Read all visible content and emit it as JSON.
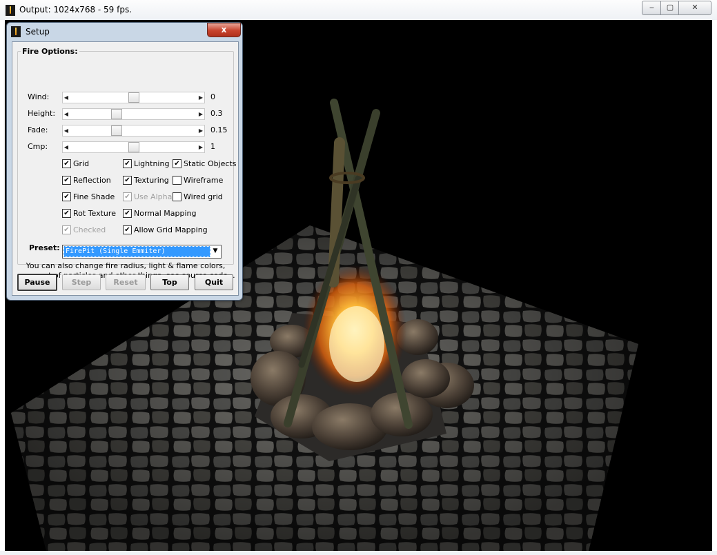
{
  "window": {
    "title": "Output: 1024x768 - 59 fps.",
    "controls": {
      "minimize": "▭",
      "maximize": "▣",
      "close": "✕"
    }
  },
  "setup": {
    "title": "Setup",
    "close": "x",
    "group_label": "Fire Options:",
    "sliders": [
      {
        "label": "Wind:",
        "value": "0",
        "position": 0.5
      },
      {
        "label": "Height:",
        "value": "0.3",
        "position": 0.35
      },
      {
        "label": "Fade:",
        "value": "0.15",
        "position": 0.35
      },
      {
        "label": "Cmp:",
        "value": "1",
        "position": 0.5
      }
    ],
    "checkboxes": {
      "grid": {
        "label": "Grid",
        "checked": true,
        "enabled": true
      },
      "lightning": {
        "label": "Lightning",
        "checked": true,
        "enabled": true
      },
      "static_objects": {
        "label": "Static Objects",
        "checked": true,
        "enabled": true
      },
      "reflection": {
        "label": "Reflection",
        "checked": true,
        "enabled": true
      },
      "texturing": {
        "label": "Texturing",
        "checked": true,
        "enabled": true
      },
      "wireframe": {
        "label": "Wireframe",
        "checked": false,
        "enabled": true
      },
      "fine_shade": {
        "label": "Fine Shade",
        "checked": true,
        "enabled": true
      },
      "use_alpha": {
        "label": "Use Alpha",
        "checked": true,
        "enabled": false
      },
      "wired_grid": {
        "label": "Wired grid",
        "checked": false,
        "enabled": true
      },
      "rot_texture": {
        "label": "Rot Texture",
        "checked": true,
        "enabled": true
      },
      "normal_mapping": {
        "label": "Normal Mapping",
        "checked": true,
        "enabled": true
      },
      "checked": {
        "label": "Checked",
        "checked": true,
        "enabled": false
      },
      "allow_grid_mapping": {
        "label": "Allow Grid Mapping",
        "checked": true,
        "enabled": true
      }
    },
    "preset": {
      "label": "Preset:",
      "value": "FirePit (Single Emmiter)"
    },
    "info": {
      "line1": "You can also change fire radius, light & flame colors,",
      "line2": "amount of particles and other things, see source code..."
    },
    "buttons": {
      "pause": "Pause",
      "step": "Step",
      "reset": "Reset",
      "top": "Top",
      "quit": "Quit"
    }
  },
  "colors": {
    "accent_selection": "#3399ff",
    "close_button": "#c7422c",
    "dialog_frame": "#c9d7e6",
    "fire_core": "#ffd24a"
  }
}
